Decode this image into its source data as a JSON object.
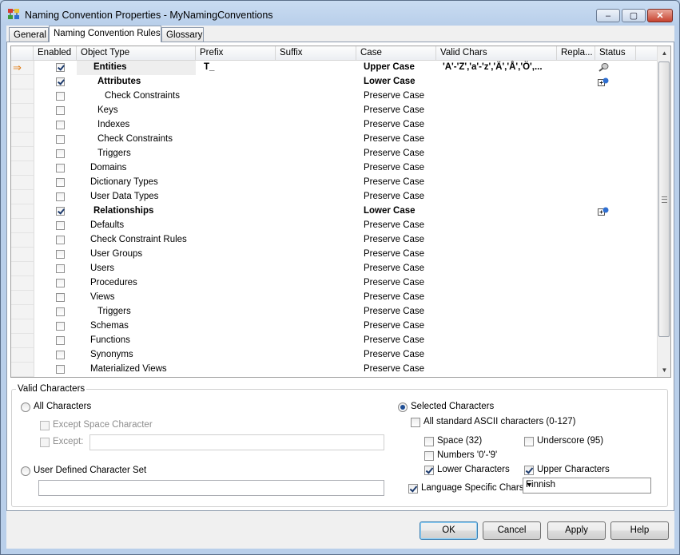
{
  "window": {
    "title": "Naming Convention Properties - MyNamingConventions",
    "minimize": "–",
    "maximize": "▢",
    "close": "✕"
  },
  "tabs": [
    {
      "label": "General"
    },
    {
      "label": "Naming Convention Rules"
    },
    {
      "label": "Glossary"
    }
  ],
  "grid": {
    "columns": [
      "Enabled",
      "Object Type",
      "Prefix",
      "Suffix",
      "Case",
      "Valid Chars",
      "Repla...",
      "Status"
    ],
    "rows": [
      {
        "name": "Entities",
        "indent": 1,
        "bold": true,
        "enabled": true,
        "prefix": "T_",
        "case": "Upper Case",
        "case_bold": true,
        "valid": "'A'-'Z','a'-'z','Ä','Å','Ö',...",
        "status": "edit-icon",
        "current": true
      },
      {
        "name": "Attributes",
        "indent": 2,
        "bold": true,
        "enabled": true,
        "prefix": "",
        "case": "Lower Case",
        "case_bold": true,
        "valid": "",
        "status": "inherit-icon"
      },
      {
        "name": "Check Constraints",
        "indent": 3,
        "bold": false,
        "enabled": false,
        "prefix": "",
        "case": "Preserve Case",
        "case_bold": false,
        "valid": "",
        "status": ""
      },
      {
        "name": "Keys",
        "indent": 2,
        "bold": false,
        "enabled": false,
        "prefix": "",
        "case": "Preserve Case",
        "case_bold": false,
        "valid": "",
        "status": ""
      },
      {
        "name": "Indexes",
        "indent": 2,
        "bold": false,
        "enabled": false,
        "prefix": "",
        "case": "Preserve Case",
        "case_bold": false,
        "valid": "",
        "status": ""
      },
      {
        "name": "Check Constraints",
        "indent": 2,
        "bold": false,
        "enabled": false,
        "prefix": "",
        "case": "Preserve Case",
        "case_bold": false,
        "valid": "",
        "status": ""
      },
      {
        "name": "Triggers",
        "indent": 2,
        "bold": false,
        "enabled": false,
        "prefix": "",
        "case": "Preserve Case",
        "case_bold": false,
        "valid": "",
        "status": ""
      },
      {
        "name": "Domains",
        "indent": 0,
        "bold": false,
        "enabled": false,
        "prefix": "",
        "case": "Preserve Case",
        "case_bold": false,
        "valid": "",
        "status": ""
      },
      {
        "name": "Dictionary Types",
        "indent": 0,
        "bold": false,
        "enabled": false,
        "prefix": "",
        "case": "Preserve Case",
        "case_bold": false,
        "valid": "",
        "status": ""
      },
      {
        "name": "User Data Types",
        "indent": 0,
        "bold": false,
        "enabled": false,
        "prefix": "",
        "case": "Preserve Case",
        "case_bold": false,
        "valid": "",
        "status": ""
      },
      {
        "name": "Relationships",
        "indent": 1,
        "bold": true,
        "enabled": true,
        "prefix": "",
        "case": "Lower Case",
        "case_bold": true,
        "valid": "",
        "status": "inherit-icon"
      },
      {
        "name": "Defaults",
        "indent": 0,
        "bold": false,
        "enabled": false,
        "prefix": "",
        "case": "Preserve Case",
        "case_bold": false,
        "valid": "",
        "status": ""
      },
      {
        "name": "Check Constraint Rules",
        "indent": 0,
        "bold": false,
        "enabled": false,
        "prefix": "",
        "case": "Preserve Case",
        "case_bold": false,
        "valid": "",
        "status": ""
      },
      {
        "name": "User Groups",
        "indent": 0,
        "bold": false,
        "enabled": false,
        "prefix": "",
        "case": "Preserve Case",
        "case_bold": false,
        "valid": "",
        "status": ""
      },
      {
        "name": "Users",
        "indent": 0,
        "bold": false,
        "enabled": false,
        "prefix": "",
        "case": "Preserve Case",
        "case_bold": false,
        "valid": "",
        "status": ""
      },
      {
        "name": "Procedures",
        "indent": 0,
        "bold": false,
        "enabled": false,
        "prefix": "",
        "case": "Preserve Case",
        "case_bold": false,
        "valid": "",
        "status": ""
      },
      {
        "name": "Views",
        "indent": 0,
        "bold": false,
        "enabled": false,
        "prefix": "",
        "case": "Preserve Case",
        "case_bold": false,
        "valid": "",
        "status": ""
      },
      {
        "name": "Triggers",
        "indent": 2,
        "bold": false,
        "enabled": false,
        "prefix": "",
        "case": "Preserve Case",
        "case_bold": false,
        "valid": "",
        "status": ""
      },
      {
        "name": "Schemas",
        "indent": 0,
        "bold": false,
        "enabled": false,
        "prefix": "",
        "case": "Preserve Case",
        "case_bold": false,
        "valid": "",
        "status": ""
      },
      {
        "name": "Functions",
        "indent": 0,
        "bold": false,
        "enabled": false,
        "prefix": "",
        "case": "Preserve Case",
        "case_bold": false,
        "valid": "",
        "status": ""
      },
      {
        "name": "Synonyms",
        "indent": 0,
        "bold": false,
        "enabled": false,
        "prefix": "",
        "case": "Preserve Case",
        "case_bold": false,
        "valid": "",
        "status": ""
      },
      {
        "name": "Materialized Views",
        "indent": 0,
        "bold": false,
        "enabled": false,
        "prefix": "",
        "case": "Preserve Case",
        "case_bold": false,
        "valid": "",
        "status": ""
      }
    ]
  },
  "valid_chars": {
    "legend": "Valid Characters",
    "all_characters": {
      "label": "All Characters",
      "selected": false
    },
    "except_space": {
      "label": "Except Space Character",
      "checked": false
    },
    "except": {
      "label": "Except:",
      "checked": false,
      "value": ""
    },
    "user_defined": {
      "label": "User Defined Character Set",
      "selected": false,
      "value": ""
    },
    "selected_characters": {
      "label": "Selected Characters",
      "selected": true
    },
    "ascii": {
      "label": "All standard ASCII characters (0-127)",
      "checked": false
    },
    "space": {
      "label": "Space (32)",
      "checked": false
    },
    "underscore": {
      "label": "Underscore (95)",
      "checked": false
    },
    "numbers": {
      "label": "Numbers '0'-'9'",
      "checked": false
    },
    "lower": {
      "label": "Lower Characters",
      "checked": true
    },
    "upper": {
      "label": "Upper Characters",
      "checked": true
    },
    "language": {
      "label": "Language Specific Chars:",
      "checked": true,
      "value": "Finnish"
    }
  },
  "buttons": {
    "ok": "OK",
    "cancel": "Cancel",
    "apply": "Apply",
    "help": "Help"
  }
}
